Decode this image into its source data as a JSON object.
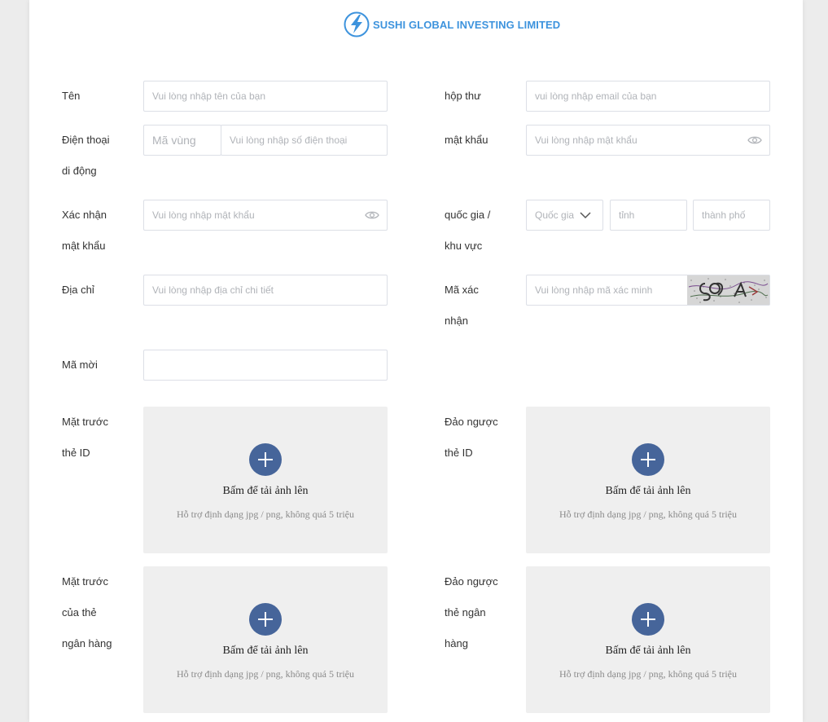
{
  "brand": {
    "name": "SUSHI GLOBAL INVESTING LIMITED",
    "logo_icon": "lightning-logo-icon",
    "color": "#3d93dd"
  },
  "form": {
    "name": {
      "label": "Tên",
      "placeholder": "Vui lòng nhập tên của bạn"
    },
    "email": {
      "label": "hộp thư",
      "placeholder": "vui lòng nhập email của bạn"
    },
    "phone": {
      "label_line1": "Điện thoại",
      "label_line2": "di động",
      "area_placeholder": "Mã vùng",
      "placeholder": "Vui lòng nhập số điện thoại"
    },
    "password": {
      "label": "mật khẩu",
      "placeholder": "Vui lòng nhập mật khẩu",
      "icon": "eye-icon"
    },
    "confirm_password": {
      "label_line1": "Xác nhận",
      "label_line2": "mật khẩu",
      "placeholder": "Vui lòng nhập mật khẩu",
      "icon": "eye-icon"
    },
    "region": {
      "label_line1": "quốc gia /",
      "label_line2": "khu vực",
      "country_placeholder": "Quốc gia",
      "province_placeholder": "tỉnh",
      "city_placeholder": "thành phố"
    },
    "address": {
      "label": "Địa chỉ",
      "placeholder": "Vui lòng nhập địa chỉ chi tiết"
    },
    "captcha": {
      "label_line1": "Mã xác",
      "label_line2": "nhận",
      "placeholder": "Vui lòng nhập mã xác minh"
    },
    "invite": {
      "label": "Mã mời",
      "value": ""
    }
  },
  "uploads": [
    {
      "label_line1": "Mặt trước",
      "label_line2": "thẻ ID",
      "label_line3": "",
      "title": "Bấm để tải ảnh lên",
      "hint": "Hỗ trợ định dạng jpg / png, không quá 5 triệu"
    },
    {
      "label_line1": "Đảo ngược",
      "label_line2": "thẻ ID",
      "label_line3": "",
      "title": "Bấm để tải ảnh lên",
      "hint": "Hỗ trợ định dạng jpg / png, không quá 5 triệu"
    },
    {
      "label_line1": "Mặt trước",
      "label_line2": "của thẻ",
      "label_line3": "ngân hàng",
      "title": "Bấm để tải ảnh lên",
      "hint": "Hỗ trợ định dạng jpg / png, không quá 5 triệu"
    },
    {
      "label_line1": "Đảo ngược",
      "label_line2": "thẻ ngân",
      "label_line3": "hàng",
      "title": "Bấm để tải ảnh lên",
      "hint": "Hỗ trợ định dạng jpg / png, không quá 5 triệu"
    }
  ],
  "colors": {
    "accent": "#46659a",
    "border": "#dcdfe6",
    "upload_bg": "#efefef",
    "page_bg": "#ececec"
  }
}
